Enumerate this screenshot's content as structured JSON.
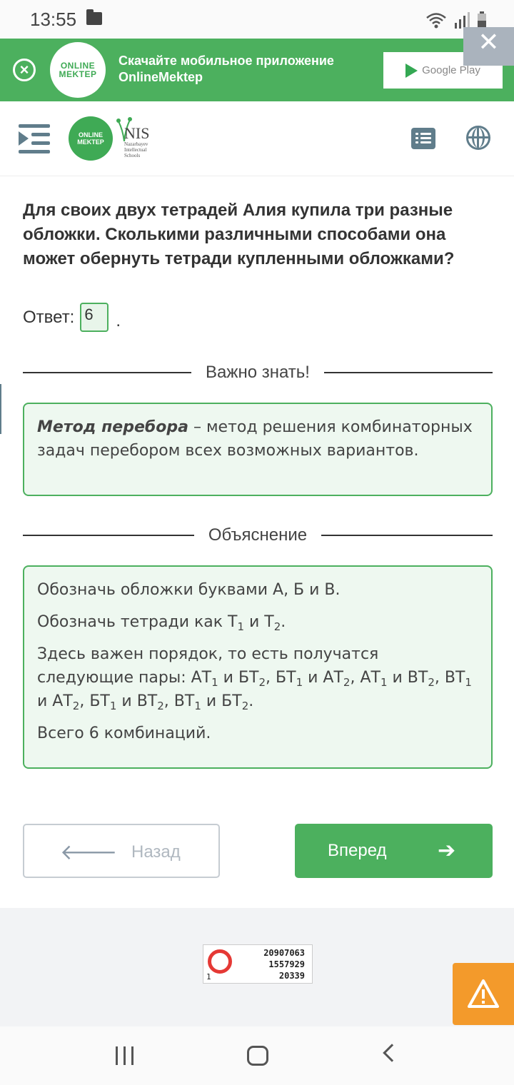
{
  "status_bar": {
    "time": "13:55"
  },
  "banner": {
    "logo_line1": "ONLINE",
    "logo_line2": "MEKTEP",
    "text_line1": "Скачайте мобильное приложение",
    "text_line2": "OnlineMektep",
    "store_label": "Google Play"
  },
  "header": {
    "om_logo_line1": "ONLINE",
    "om_logo_line2": "MEKTEP",
    "nis_title": "NIS",
    "nis_sub1": "Nazarbayev",
    "nis_sub2": "Intellectual",
    "nis_sub3": "Schools"
  },
  "task": {
    "question": "Для своих двух тетрадей Алия купила три разные обложки. Сколькими различными способами она может обернуть тетради купленными обложками?",
    "answer_label": "Ответ:",
    "answer_value": "6",
    "answer_suffix": "."
  },
  "important": {
    "heading": "Важно знать!",
    "term": "Метод перебора",
    "definition": " – метод решения комбинаторных задач перебором всех возможных вариантов."
  },
  "explanation": {
    "heading": "Объяснение",
    "p1": "Обозначь обложки буквами А, Б и В.",
    "p2_prefix": "Обозначь тетради как Т",
    "p2_mid": " и Т",
    "p2_suffix": ".",
    "p3_intro": "Здесь важен порядок, то есть получатся следующие пары: ",
    "pairs": [
      {
        "a": "АТ",
        "ai": "1",
        "j": " и ",
        "b": "БТ",
        "bi": "2",
        "sep": ", "
      },
      {
        "a": "БТ",
        "ai": "1",
        "j": " и ",
        "b": "АТ",
        "bi": "2",
        "sep": ", "
      },
      {
        "a": "АТ",
        "ai": "1",
        "j": " и ",
        "b": "ВТ",
        "bi": "2",
        "sep": ", "
      },
      {
        "a": "ВТ",
        "ai": "1",
        "j": " и ",
        "b": "АТ",
        "bi": "2",
        "sep": ", "
      },
      {
        "a": "БТ",
        "ai": "1",
        "j": " и ",
        "b": "ВТ",
        "bi": "2",
        "sep": ", "
      },
      {
        "a": "ВТ",
        "ai": "1",
        "j": " и ",
        "b": "БТ",
        "bi": "2",
        "sep": "."
      }
    ],
    "p4": "Всего 6 комбинаций."
  },
  "navigation": {
    "back_label": "Назад",
    "next_label": "Вперед",
    "back_arrow": "🡐",
    "next_arrow": "➔"
  },
  "counter": {
    "line1": "20907063",
    "line2": "1557929",
    "line3": "20339",
    "corner": "1"
  },
  "colors": {
    "brand_green": "#4cb05e",
    "icon_gray": "#607d8b",
    "warning_orange": "#f39a2b"
  },
  "icons": {
    "banner_close": "close-circle-icon",
    "warning": "warning-triangle-icon"
  }
}
